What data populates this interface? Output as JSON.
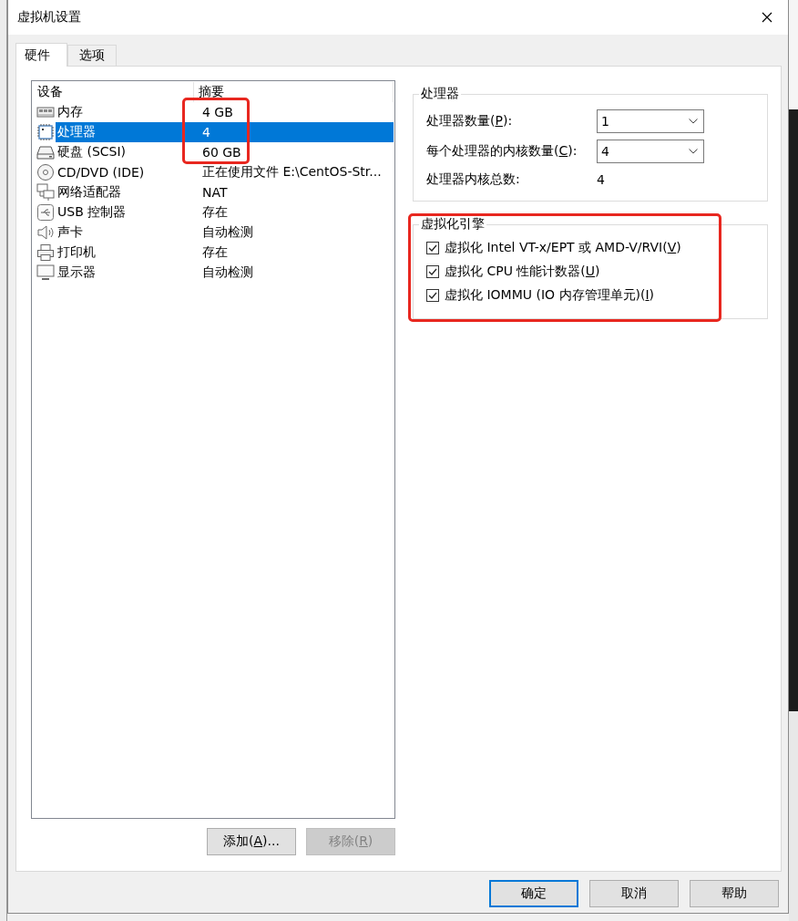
{
  "window": {
    "title": "虚拟机设置"
  },
  "tabs": [
    {
      "label": "硬件",
      "selected": true
    },
    {
      "label": "选项",
      "selected": false
    }
  ],
  "device_list": {
    "columns": [
      "设备",
      "摘要"
    ],
    "rows": [
      {
        "kind": "memory",
        "name": "内存",
        "summary": "4 GB",
        "selected": false,
        "highlighted": true
      },
      {
        "kind": "cpu",
        "name": "处理器",
        "summary": "4",
        "selected": true,
        "highlighted": true
      },
      {
        "kind": "disk",
        "name": "硬盘 (SCSI)",
        "summary": "60 GB",
        "selected": false,
        "highlighted": true
      },
      {
        "kind": "cdrom",
        "name": "CD/DVD (IDE)",
        "summary": "正在使用文件 E:\\CentOS-Str...",
        "selected": false,
        "highlighted": false
      },
      {
        "kind": "network",
        "name": "网络适配器",
        "summary": "NAT",
        "selected": false,
        "highlighted": false
      },
      {
        "kind": "usb",
        "name": "USB 控制器",
        "summary": "存在",
        "selected": false,
        "highlighted": false
      },
      {
        "kind": "sound",
        "name": "声卡",
        "summary": "自动检测",
        "selected": false,
        "highlighted": false
      },
      {
        "kind": "printer",
        "name": "打印机",
        "summary": "存在",
        "selected": false,
        "highlighted": false
      },
      {
        "kind": "display",
        "name": "显示器",
        "summary": "自动检测",
        "selected": false,
        "highlighted": false
      }
    ]
  },
  "list_buttons": [
    {
      "label": [
        "添加(",
        "A",
        ")..."
      ],
      "disabled": false
    },
    {
      "label": [
        "移除(",
        "R",
        ")"
      ],
      "disabled": true
    }
  ],
  "processors": {
    "title": "处理器",
    "fields": [
      {
        "kind": "select",
        "label": [
          "处理器数量(",
          "P",
          "):"
        ],
        "value": "1"
      },
      {
        "kind": "select",
        "label": [
          "每个处理器的内核数量(",
          "C",
          "):"
        ],
        "value": "4"
      },
      {
        "kind": "text",
        "label": [
          "处理器内核总数:"
        ],
        "value": "4"
      }
    ]
  },
  "virtualization": {
    "title": "虚拟化引擎",
    "highlighted": true,
    "options": [
      {
        "label": [
          "虚拟化 Intel VT-x/EPT 或 AMD-V/RVI(",
          "V",
          ")"
        ],
        "checked": true
      },
      {
        "label": [
          "虚拟化 CPU 性能计数器(",
          "U",
          ")"
        ],
        "checked": true
      },
      {
        "label": [
          "虚拟化 IOMMU (IO 内存管理单元)(",
          "I",
          ")"
        ],
        "checked": true
      }
    ]
  },
  "buttons": [
    {
      "label": "确定",
      "default": true
    },
    {
      "label": "取消",
      "default": false
    },
    {
      "label": "帮助",
      "default": false
    }
  ]
}
